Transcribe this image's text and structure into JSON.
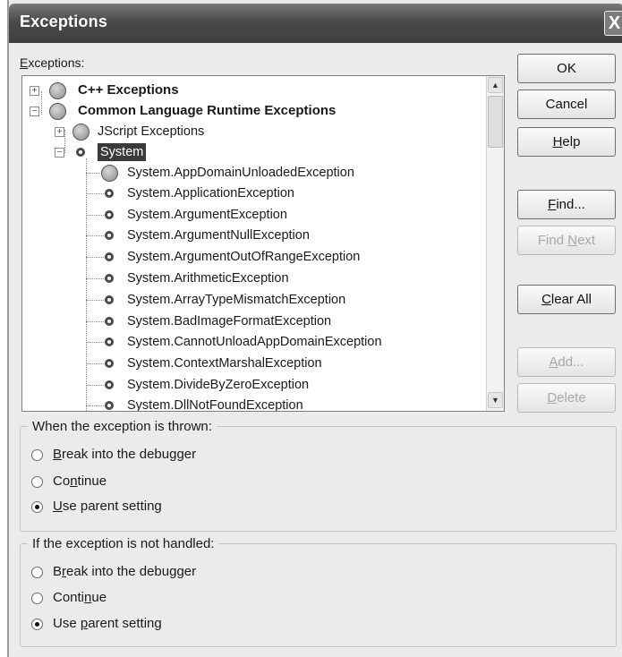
{
  "window": {
    "title": "Exceptions",
    "close_glyph": "X"
  },
  "exceptions_label": "Exceptions:",
  "tree": {
    "cpp": "C++ Exceptions",
    "clr": "Common Language Runtime Exceptions",
    "jscript": "JScript Exceptions",
    "system": "System",
    "items": [
      "System.AppDomainUnloadedException",
      "System.ApplicationException",
      "System.ArgumentException",
      "System.ArgumentNullException",
      "System.ArgumentOutOfRangeException",
      "System.ArithmeticException",
      "System.ArrayTypeMismatchException",
      "System.BadImageFormatException",
      "System.CannotUnloadAppDomainException",
      "System.ContextMarshalException",
      "System.DivideByZeroException",
      "System.DllNotFoundException"
    ]
  },
  "buttons": {
    "ok": "OK",
    "cancel": "Cancel",
    "help_rest": "elp",
    "help_u": "H",
    "find_u": "F",
    "find_rest": "ind...",
    "findnext_pre": "Find ",
    "findnext_u": "N",
    "findnext_rest": "ext",
    "clearall_u": "C",
    "clearall_rest": "lear All",
    "add_u": "A",
    "add_rest": "dd...",
    "delete_u": "D",
    "delete_rest": "elete"
  },
  "thrown_group": {
    "title": "When the exception is thrown:",
    "options": [
      {
        "u": "B",
        "rest": "reak into the debugger",
        "pre": "",
        "checked": false
      },
      {
        "pre": "Co",
        "u": "n",
        "rest": "tinue",
        "checked": false
      },
      {
        "u": "U",
        "rest": "se parent setting",
        "pre": "",
        "checked": true
      }
    ]
  },
  "unhandled_group": {
    "title": "If the exception is not handled:",
    "options": [
      {
        "pre": "B",
        "u": "r",
        "rest": "eak into the debugger",
        "checked": false
      },
      {
        "pre": "Conti",
        "u": "n",
        "rest": "ue",
        "checked": false
      },
      {
        "pre": "Use ",
        "u": "p",
        "rest": "arent setting",
        "checked": true
      }
    ]
  }
}
